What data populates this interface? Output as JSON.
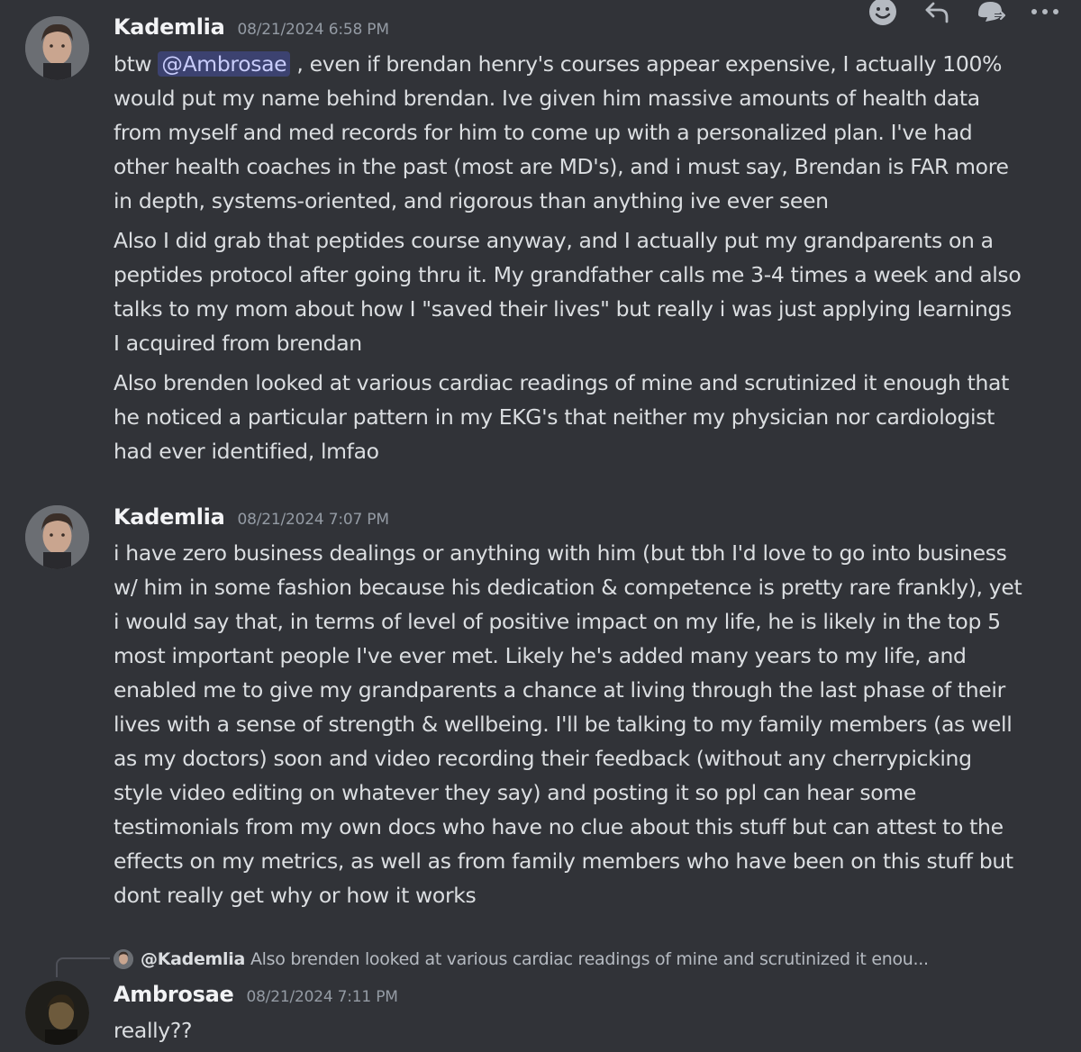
{
  "toolbar": {
    "icons": [
      "emoji-icon",
      "reply-icon",
      "forward-icon",
      "more-icon"
    ]
  },
  "messages": [
    {
      "username": "Kademlia",
      "timestamp": "08/21/2024 6:58 PM",
      "paragraphs": [
        {
          "before": "btw ",
          "mention": "@Ambrosae",
          "after": " , even if brendan henry's courses appear expensive, I actually 100% would put my name behind brendan. Ive given him massive amounts of health data from myself and med records for him to come up with a personalized plan. I've had other health coaches in the past (most are MD's), and i must say, Brendan is FAR more in depth, systems-oriented, and rigorous than anything ive ever seen"
        },
        {
          "text": "Also I did grab that peptides course anyway, and I actually put my grandparents on a peptides protocol after going thru it. My grandfather calls me 3-4 times a week and also talks to my mom about how I \"saved their lives\" but really i was just applying learnings I acquired from brendan"
        },
        {
          "text": "Also brenden looked at various cardiac readings of mine and scrutinized it enough that he noticed a particular pattern in my EKG's that neither my physician nor cardiologist had ever identified, lmfao"
        }
      ]
    },
    {
      "username": "Kademlia",
      "timestamp": "08/21/2024 7:07 PM",
      "text": "i have zero business dealings or anything with him (but tbh I'd love to go into business w/ him in some fashion because his dedication & competence is pretty rare frankly), yet i would say that, in terms of level of positive impact on my life, he is likely in the top 5 most important people I've ever met. Likely he's added many years to my life, and enabled me to give my grandparents a chance at living through the last phase of their lives with a sense of strength & wellbeing. I'll be talking to my family members (as well as my doctors) soon and video recording their feedback (without any cherrypicking style video editing on whatever they say) and posting it so ppl can hear some testimonials from my own docs who have no clue about this stuff but can attest to the effects on my metrics, as well as from family members who have been on this stuff but dont really get why or how it works"
    },
    {
      "reply_to_user": "@Kademlia",
      "reply_preview": "Also brenden looked at various cardiac readings of mine and scrutinized it enou...",
      "username": "Ambrosae",
      "timestamp": "08/21/2024 7:11 PM",
      "text": "really??"
    }
  ]
}
